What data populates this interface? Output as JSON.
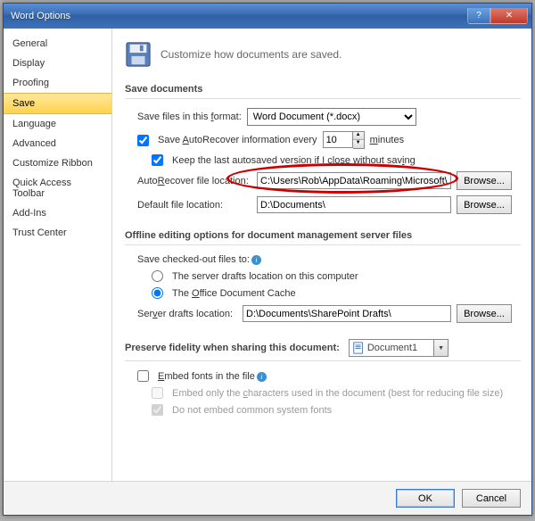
{
  "window": {
    "title": "Word Options"
  },
  "sidebar": {
    "items": [
      {
        "label": "General"
      },
      {
        "label": "Display"
      },
      {
        "label": "Proofing"
      },
      {
        "label": "Save"
      },
      {
        "label": "Language"
      },
      {
        "label": "Advanced"
      },
      {
        "label": "Customize Ribbon"
      },
      {
        "label": "Quick Access Toolbar"
      },
      {
        "label": "Add-Ins"
      },
      {
        "label": "Trust Center"
      }
    ],
    "selected_index": 3
  },
  "header": {
    "text": "Customize how documents are saved."
  },
  "save_documents": {
    "title": "Save documents",
    "format_label_pre": "Save files in this ",
    "format_label_u": "f",
    "format_label_post": "ormat:",
    "format_value": "Word Document (*.docx)",
    "autorecover_label_pre": "Save ",
    "autorecover_label_u": "A",
    "autorecover_label_post": "utoRecover information every",
    "autorecover_value": "10",
    "minutes_u": "m",
    "minutes_post": "inutes",
    "keep_last_pre": "Keep the last autosaved version if I close without sav",
    "keep_last_u": "i",
    "keep_last_post": "ng",
    "ar_loc_label_pre": "Auto",
    "ar_loc_label_u": "R",
    "ar_loc_label_post": "ecover file location:",
    "ar_loc_value": "C:\\Users\\Rob\\AppData\\Roaming\\Microsoft\\Word\\",
    "default_loc_label": "Default file location:",
    "default_loc_value": "D:\\Documents\\",
    "browse": "Browse..."
  },
  "offline": {
    "title": "Offline editing options for document management server files",
    "checked_out_label": "Save checked-out files to:",
    "opt1": "The server drafts location on this computer",
    "opt2_pre": "The ",
    "opt2_u": "O",
    "opt2_post": "ffice Document Cache",
    "drafts_label_pre": "Ser",
    "drafts_label_u": "v",
    "drafts_label_post": "er drafts location:",
    "drafts_value": "D:\\Documents\\SharePoint Drafts\\",
    "browse": "Browse..."
  },
  "fidelity": {
    "title_pre": "Preserve fidelity when sharing this document:",
    "doc_name": "Document1",
    "embed_pre": "",
    "embed_u": "E",
    "embed_post": "mbed fonts in the file",
    "only_chars_pre": "Embed only the ",
    "only_chars_u": "c",
    "only_chars_post": "haracters used in the document (best for reducing file size)",
    "no_common": "Do not embed common system fonts"
  },
  "footer": {
    "ok": "OK",
    "cancel": "Cancel"
  }
}
